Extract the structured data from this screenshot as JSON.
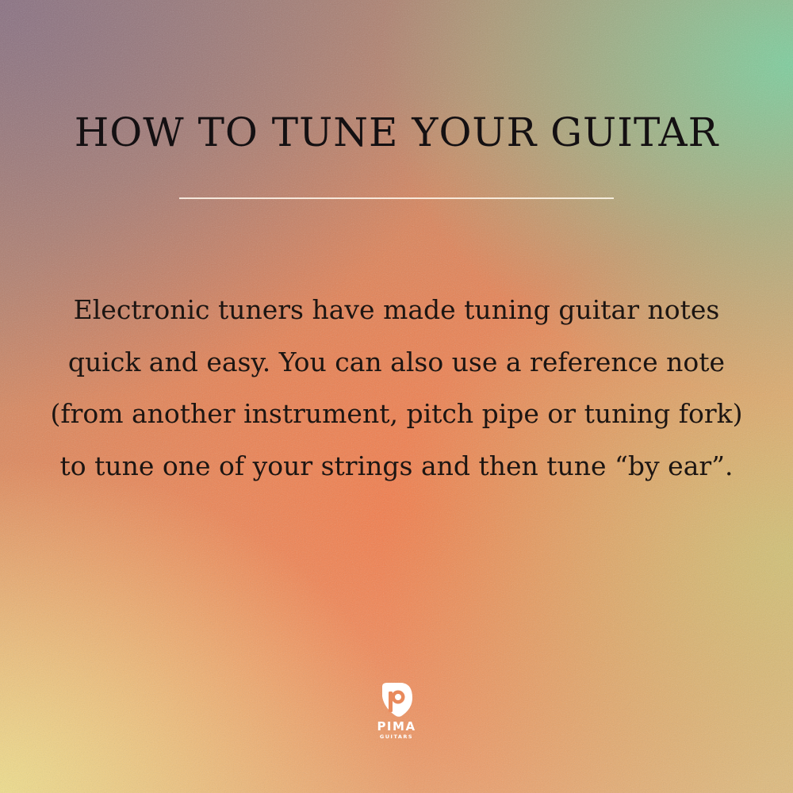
{
  "post": {
    "title": "HOW TO TUNE YOUR GUITAR",
    "body": "Electronic tuners have made tuning guitar notes quick and easy. You can also use a reference note (from another instrument, pitch pipe or tuning fork) to tune one of your strings and then tune “by ear”."
  },
  "brand": {
    "name": "PIMA",
    "tagline": "GUITARS",
    "icon": "pima-pick-logo-icon"
  },
  "colors": {
    "text": "#141012",
    "divider": "#fff8ec",
    "logo": "#ffffff",
    "gradient_top_left": "#876e82",
    "gradient_top_right": "#78d2a0",
    "gradient_center": "#f57846",
    "gradient_bottom_left": "#f0e18c"
  }
}
